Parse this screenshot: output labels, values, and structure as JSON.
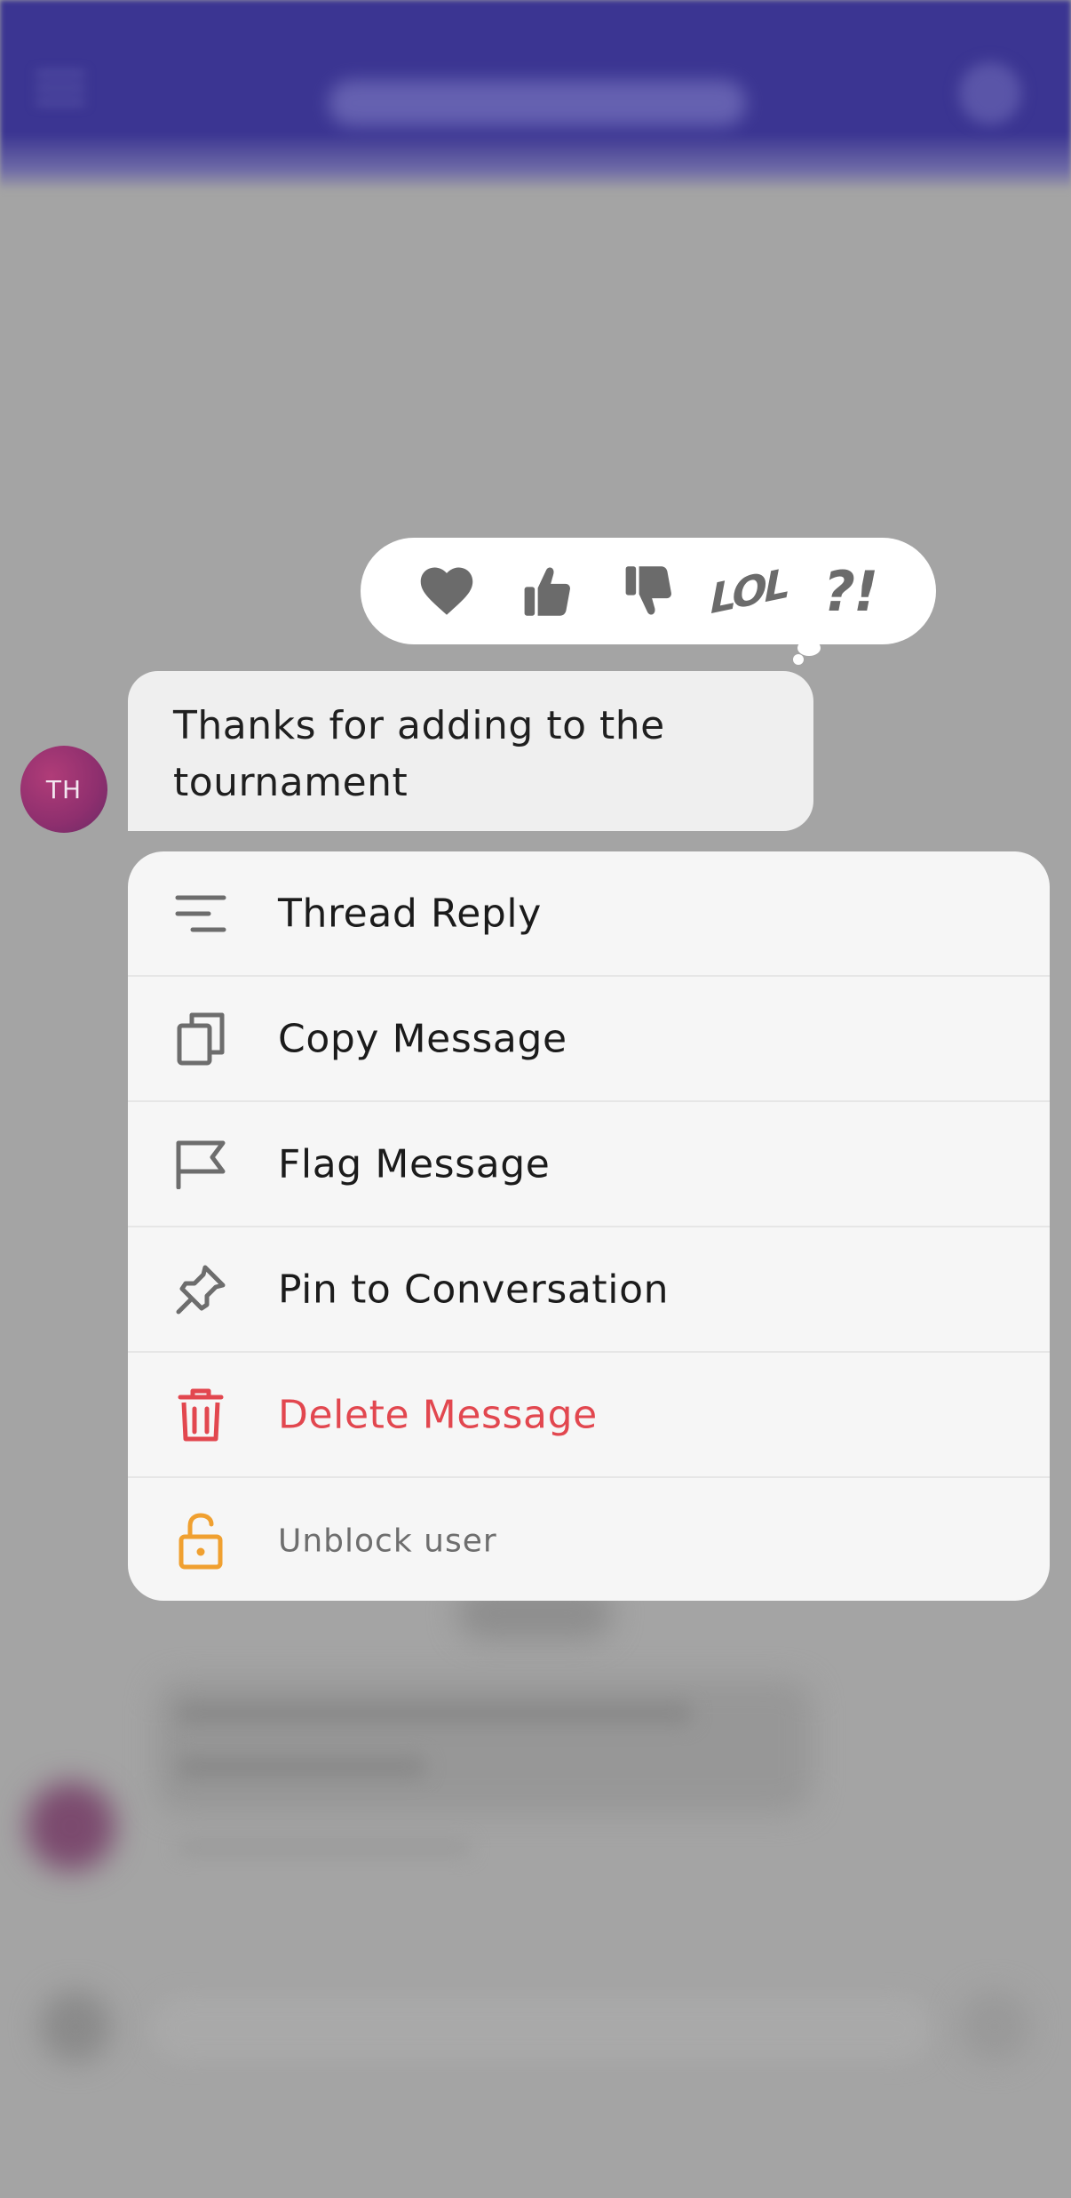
{
  "reactions": [
    {
      "name": "heart-icon"
    },
    {
      "name": "thumbs-up-icon"
    },
    {
      "name": "thumbs-down-icon"
    },
    {
      "name": "lol",
      "text": "LOL"
    },
    {
      "name": "interrobang",
      "text": "?!"
    }
  ],
  "message": {
    "avatar_initials": "TH",
    "text": "Thanks for adding to the tournament"
  },
  "menu": {
    "thread_reply": "Thread Reply",
    "copy_message": "Copy Message",
    "flag_message": "Flag Message",
    "pin_to_conversation": "Pin to Conversation",
    "delete_message": "Delete Message",
    "unblock_user": "Unblock user"
  },
  "colors": {
    "header": "#3b3592",
    "overlay": "#a4a4a4",
    "reaction_icon": "#6b6b6b",
    "danger": "#e2474f",
    "warning": "#f0a030",
    "avatar": "#9a3372"
  }
}
